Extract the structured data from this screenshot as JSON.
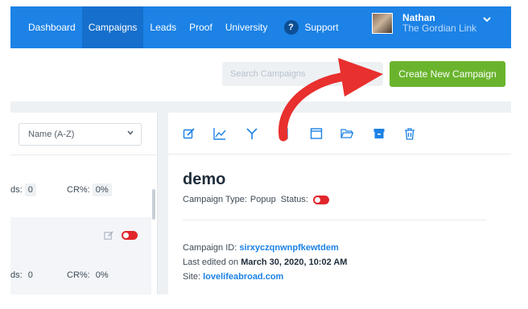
{
  "nav": {
    "items": [
      {
        "label": "Dashboard",
        "active": false
      },
      {
        "label": "Campaigns",
        "active": true
      },
      {
        "label": "Leads",
        "active": false
      },
      {
        "label": "Proof",
        "active": false
      },
      {
        "label": "University",
        "active": false
      }
    ],
    "support_badge": "?",
    "support_label": "Support",
    "user_name": "Nathan",
    "user_org": "The Gordian Link"
  },
  "toolbar": {
    "search_placeholder": "Search Campaigns",
    "create_label": "Create New Campaign"
  },
  "list": {
    "sort_value": "Name (A-Z)",
    "rows": [
      {
        "leads_label": "ds:",
        "leads_value": "0",
        "cr_label": "CR%:",
        "cr_value": "0%"
      },
      {
        "leads_label": "ds:",
        "leads_value": "0",
        "cr_label": "CR%:",
        "cr_value": "0%"
      }
    ]
  },
  "detail": {
    "toolbar_icons": [
      "edit-icon",
      "stats-icon",
      "split-test-icon",
      "mobile-icon",
      "window-icon",
      "folder-icon",
      "archive-icon",
      "trash-icon"
    ],
    "title": "demo",
    "type_label": "Campaign Type:",
    "type_value": "Popup",
    "status_label": "Status:",
    "id_label": "Campaign ID:",
    "id_value": "sirxyczqnwnpfkewtdem",
    "edited_label": "Last edited on",
    "edited_value": "March 30, 2020, 10:02 AM",
    "site_label": "Site:",
    "site_value": "lovelifeabroad.com"
  },
  "colors": {
    "nav_bg": "#1c82e6",
    "create_button": "#6ab42d",
    "status_off": "#e0262b",
    "annotation_arrow": "#e8302e",
    "link": "#1c82e6"
  }
}
